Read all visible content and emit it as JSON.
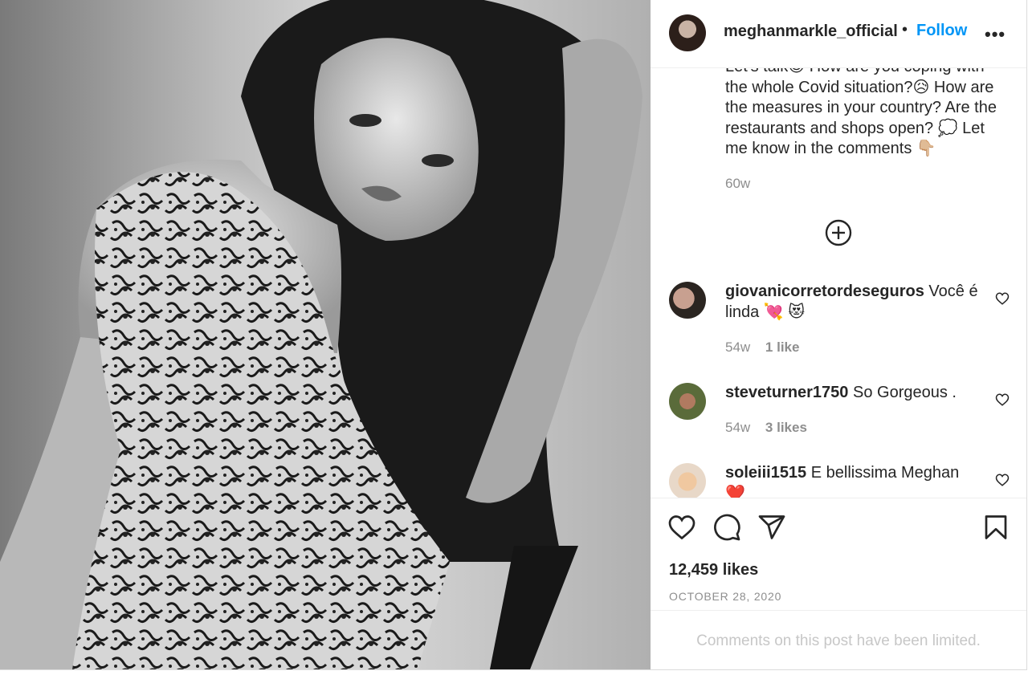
{
  "post": {
    "username": "meghanmarkle_official",
    "separator": "•",
    "follow_label": "Follow",
    "more_label": "•••",
    "caption": "Let's talk😊 How are you coping with the whole Covid situation?😥 How are the measures in your country? Are the restaurants and shops open? 💭 Let me know in the comments 👇🏼",
    "caption_time": "60w",
    "likes": "12,459 likes",
    "date": "OCTOBER 28, 2020",
    "comments_limited": "Comments on this post have been limited."
  },
  "comments": [
    {
      "username": "giovanicorretordeseguros",
      "text": "Você é linda 💘 😻",
      "time": "54w",
      "likes": "1 like"
    },
    {
      "username": "steveturner1750",
      "text": "So Gorgeous .",
      "time": "54w",
      "likes": "3 likes"
    },
    {
      "username": "soleiii1515",
      "text": "E bellissima Meghan ❤️"
    }
  ],
  "icons": {
    "like": "heart-icon",
    "comment": "comment-icon",
    "share": "paper-plane-icon",
    "save": "bookmark-icon",
    "load_more": "plus-circle-icon",
    "comment_like": "heart-icon"
  },
  "colors": {
    "accent": "#0095f6",
    "text": "#262626",
    "secondary": "#8e8e8e",
    "muted": "#c7c7c7"
  }
}
